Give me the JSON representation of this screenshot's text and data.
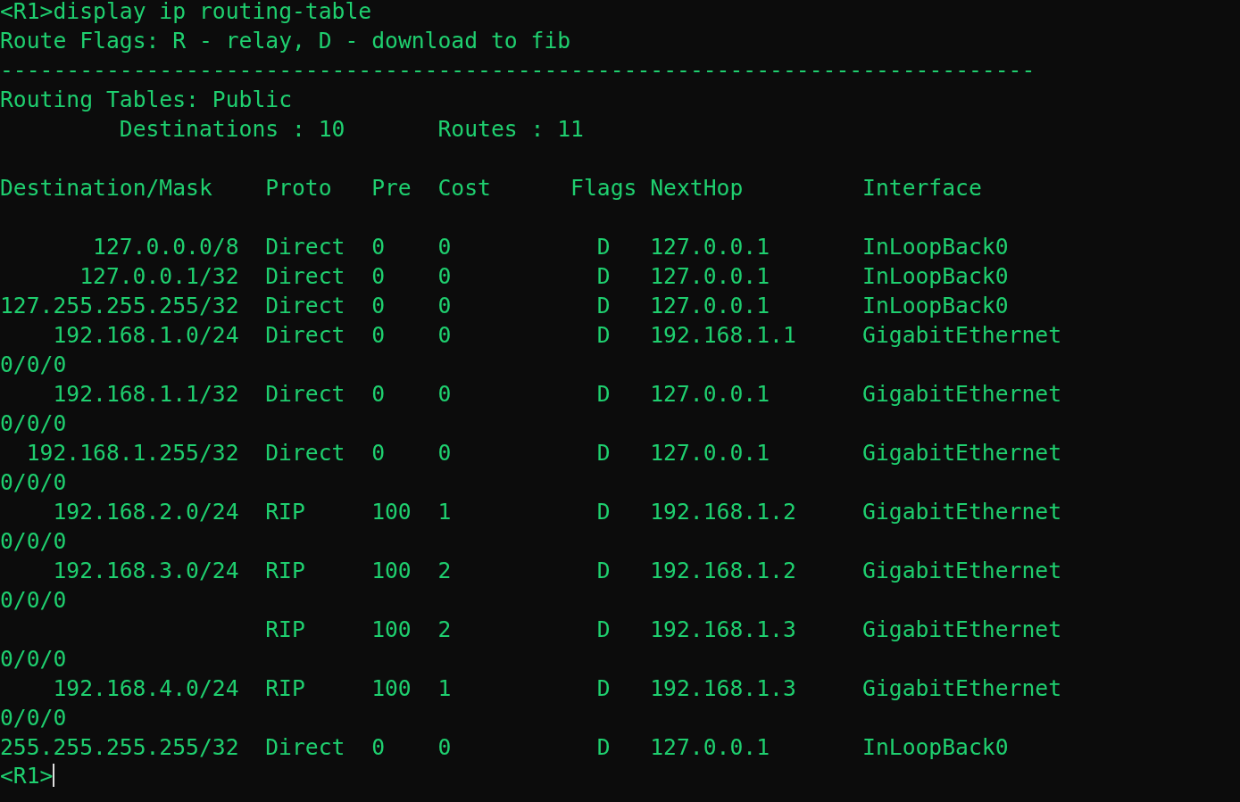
{
  "command": "<R1>display ip routing-table",
  "route_flags": "Route Flags: R - relay, D - download to fib",
  "separator": "------------------------------------------------------------------------------",
  "routing_tables": "Routing Tables: Public",
  "summary": {
    "destinations_label": "Destinations : 10",
    "routes_label": "Routes : 11"
  },
  "table": {
    "columns": [
      "Destination/Mask",
      "Proto",
      "Pre",
      "Cost",
      "Flags",
      "NextHop",
      "Interface"
    ],
    "rows": [
      {
        "destination": "127.0.0.0/8",
        "proto": "Direct",
        "pre": "0",
        "cost": "0",
        "flags": "D",
        "nexthop": "127.0.0.1",
        "interface": "InLoopBack0"
      },
      {
        "destination": "127.0.0.1/32",
        "proto": "Direct",
        "pre": "0",
        "cost": "0",
        "flags": "D",
        "nexthop": "127.0.0.1",
        "interface": "InLoopBack0"
      },
      {
        "destination": "127.255.255.255/32",
        "proto": "Direct",
        "pre": "0",
        "cost": "0",
        "flags": "D",
        "nexthop": "127.0.0.1",
        "interface": "InLoopBack0"
      },
      {
        "destination": "192.168.1.0/24",
        "proto": "Direct",
        "pre": "0",
        "cost": "0",
        "flags": "D",
        "nexthop": "192.168.1.1",
        "interface": "GigabitEthernet",
        "interface_continued": "0/0/0"
      },
      {
        "destination": "192.168.1.1/32",
        "proto": "Direct",
        "pre": "0",
        "cost": "0",
        "flags": "D",
        "nexthop": "127.0.0.1",
        "interface": "GigabitEthernet",
        "interface_continued": "0/0/0"
      },
      {
        "destination": "192.168.1.255/32",
        "proto": "Direct",
        "pre": "0",
        "cost": "0",
        "flags": "D",
        "nexthop": "127.0.0.1",
        "interface": "GigabitEthernet",
        "interface_continued": "0/0/0"
      },
      {
        "destination": "192.168.2.0/24",
        "proto": "RIP",
        "pre": "100",
        "cost": "1",
        "flags": "D",
        "nexthop": "192.168.1.2",
        "interface": "GigabitEthernet",
        "interface_continued": "0/0/0"
      },
      {
        "destination": "192.168.3.0/24",
        "proto": "RIP",
        "pre": "100",
        "cost": "2",
        "flags": "D",
        "nexthop": "192.168.1.2",
        "interface": "GigabitEthernet",
        "interface_continued": "0/0/0"
      },
      {
        "proto": "RIP",
        "pre": "100",
        "cost": "2",
        "flags": "D",
        "nexthop": "192.168.1.3",
        "interface": "GigabitEthernet",
        "interface_continued": "0/0/0"
      },
      {
        "destination": "192.168.4.0/24",
        "proto": "RIP",
        "pre": "100",
        "cost": "1",
        "flags": "D",
        "nexthop": "192.168.1.3",
        "interface": "GigabitEthernet",
        "interface_continued": "0/0/0"
      },
      {
        "destination": "255.255.255.255/32",
        "proto": "Direct",
        "pre": "0",
        "cost": "0",
        "flags": "D",
        "nexthop": "127.0.0.1",
        "interface": "InLoopBack0"
      }
    ]
  },
  "prompt": "<R1>"
}
